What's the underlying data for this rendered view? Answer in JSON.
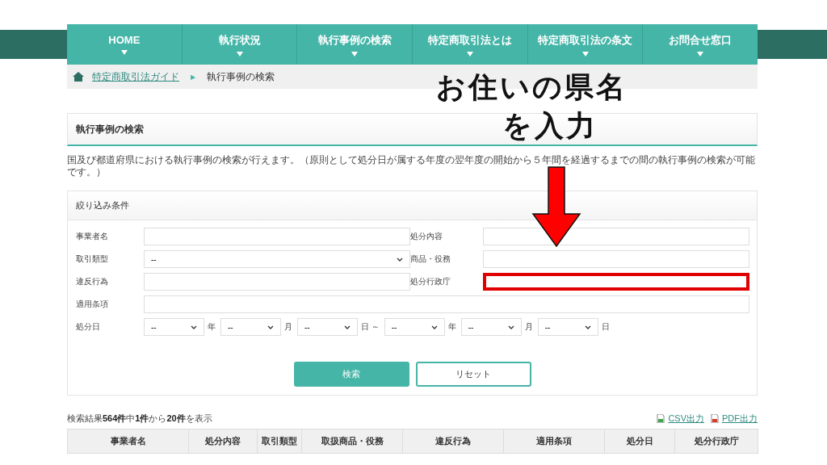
{
  "nav": [
    {
      "label": "HOME"
    },
    {
      "label": "執行状況"
    },
    {
      "label": "執行事例の検索"
    },
    {
      "label": "特定商取引法とは"
    },
    {
      "label": "特定商取引法の条文"
    },
    {
      "label": "お問合せ窓口"
    }
  ],
  "breadcrumb": {
    "link": "特定商取引法ガイド",
    "separator": "▶",
    "current": "執行事例の検索"
  },
  "page_heading": "執行事例の検索",
  "description": "国及び都道府県における執行事例の検索が行えます。（原則として処分日が属する年度の翌年度の開始から５年間を経過するまでの間の執行事例の検索が可能です。）",
  "filter": {
    "title": "絞り込み条件",
    "fields": [
      {
        "kind": "text",
        "label": "事業者名",
        "highlighted": false
      },
      {
        "kind": "text",
        "label": "処分内容",
        "highlighted": false
      },
      {
        "kind": "select",
        "label": "取引類型",
        "value": "--",
        "highlighted": false
      },
      {
        "kind": "text",
        "label": "商品・役務",
        "highlighted": false
      },
      {
        "kind": "text",
        "label": "違反行為",
        "highlighted": false
      },
      {
        "kind": "text",
        "label": "処分行政庁",
        "highlighted": true
      },
      {
        "kind": "wide_text",
        "label": "適用条項",
        "highlighted": false
      },
      {
        "kind": "date",
        "label": "処分日",
        "parts": [
          {
            "value": "--",
            "unit": "年"
          },
          {
            "value": "--",
            "unit": "月"
          },
          {
            "value": "--",
            "unit": "日 ～"
          },
          {
            "value": "--",
            "unit": "年"
          },
          {
            "value": "--",
            "unit": "月"
          },
          {
            "value": "--",
            "unit": "日"
          }
        ]
      }
    ],
    "buttons": [
      {
        "kind": "primary",
        "label": "検索"
      },
      {
        "kind": "secondary",
        "label": "リセット"
      }
    ]
  },
  "results": {
    "summary": "検索結果**564件**中**1件**から**20件**を表示",
    "exports": [
      {
        "kind": "csv",
        "label": "CSV出力"
      },
      {
        "kind": "pdf",
        "label": "PDF出力"
      }
    ],
    "columns": [
      "事業者名",
      "処分内容",
      "取引類型",
      "取扱商品・役務",
      "違反行為",
      "適用条項",
      "処分日",
      "処分行政庁"
    ]
  },
  "annotation": {
    "lines": [
      "お住いの県名",
      "を入力"
    ]
  }
}
